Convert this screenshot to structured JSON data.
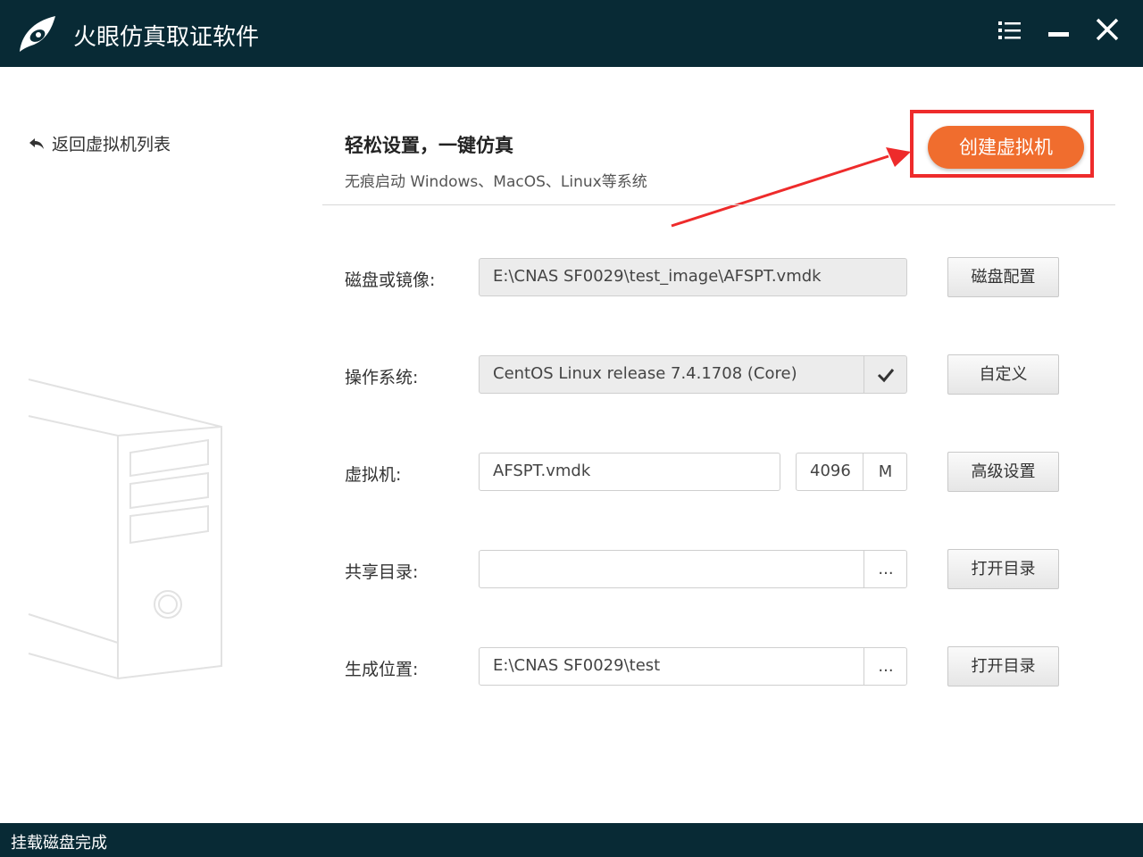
{
  "app": {
    "title": "火眼仿真取证软件"
  },
  "nav": {
    "back_label": "返回虚拟机列表"
  },
  "header": {
    "headline": "轻松设置，一键仿真",
    "subline": "无痕启动 Windows、MacOS、Linux等系统",
    "create_button": "创建虚拟机"
  },
  "form": {
    "disk": {
      "label": "磁盘或镜像:",
      "value": "E:\\CNAS SF0029\\test_image\\AFSPT.vmdk",
      "button": "磁盘配置"
    },
    "os": {
      "label": "操作系统:",
      "value": "CentOS Linux release 7.4.1708 (Core)",
      "button": "自定义"
    },
    "vm": {
      "label": "虚拟机:",
      "name": "AFSPT.vmdk",
      "memory": "4096",
      "memory_unit": "M",
      "button": "高级设置"
    },
    "share": {
      "label": "共享目录:",
      "value": "",
      "browse": "...",
      "button": "打开目录"
    },
    "output": {
      "label": "生成位置:",
      "value": "E:\\CNAS SF0029\\test",
      "browse": "...",
      "button": "打开目录"
    }
  },
  "status": {
    "text": "挂载磁盘完成"
  },
  "colors": {
    "titlebar": "#082a35",
    "accent": "#f06d2e",
    "highlight": "#ee2b2b"
  },
  "icons": [
    "app-logo-icon",
    "menu-icon",
    "minimize-icon",
    "close-icon",
    "back-arrow-icon",
    "checkmark-icon"
  ]
}
